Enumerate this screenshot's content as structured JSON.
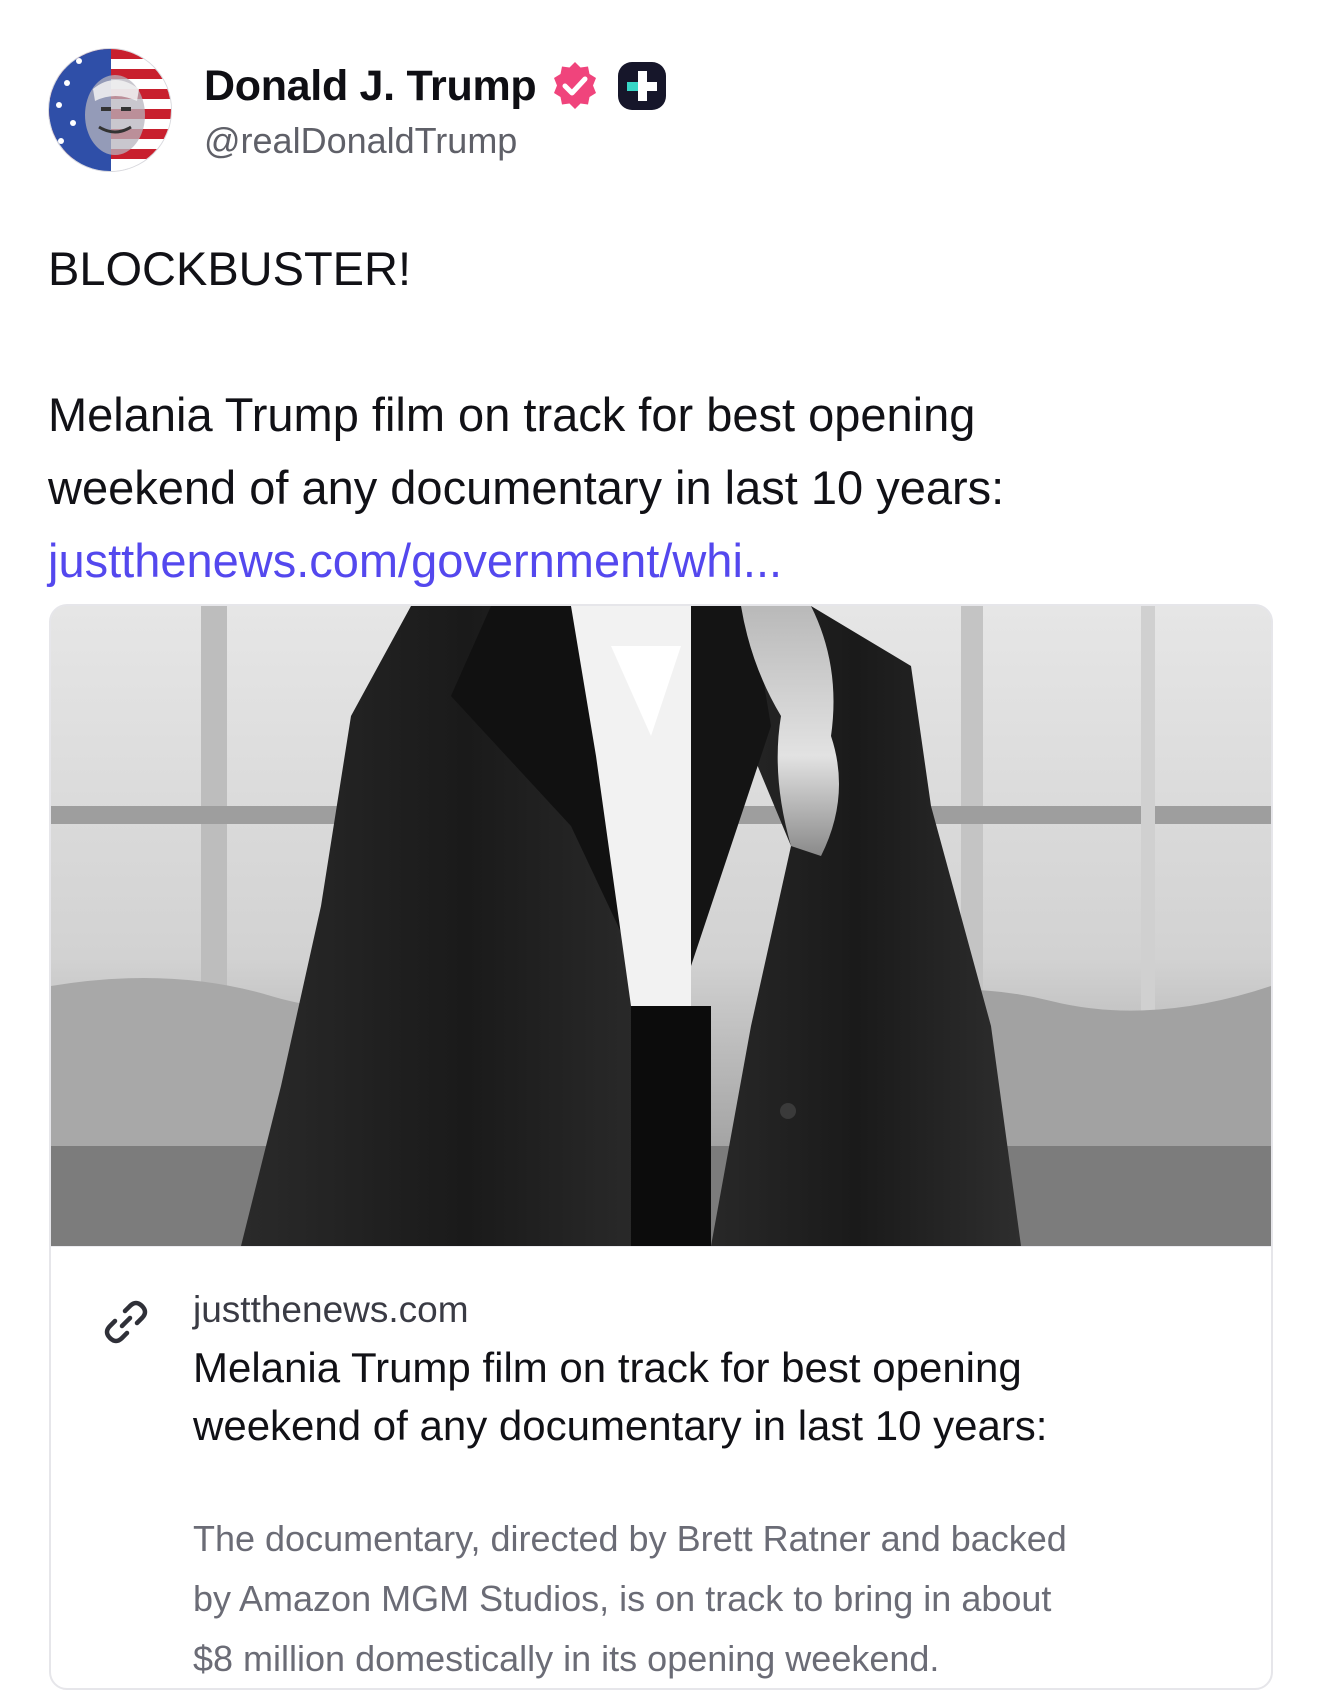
{
  "author": {
    "display_name": "Donald J. Trump",
    "handle": "@realDonaldTrump",
    "avatar_icon": "american-flag-portrait-avatar",
    "verified_icon": "verified-badge-icon",
    "verified_color": "#f0447c",
    "plus_icon": "truth-plus-icon"
  },
  "post": {
    "headline": "BLOCKBUSTER!",
    "body_lines": [
      "Melania Trump film on track for best opening",
      "weekend of any documentary in last 10 years:"
    ],
    "link_text": "justthenews.com/government/whi...",
    "link_color": "#5448ee"
  },
  "link_card": {
    "domain": "justthenews.com",
    "title_lines": [
      "Melania Trump film on track for best opening",
      "weekend of any documentary in last 10 years:"
    ],
    "description_lines": [
      "The documentary, directed by Brett Ratner and backed",
      "by Amazon MGM Studios, is on track to bring in about",
      "$8 million domestically in its opening weekend."
    ],
    "link_icon": "link-chain-icon"
  }
}
